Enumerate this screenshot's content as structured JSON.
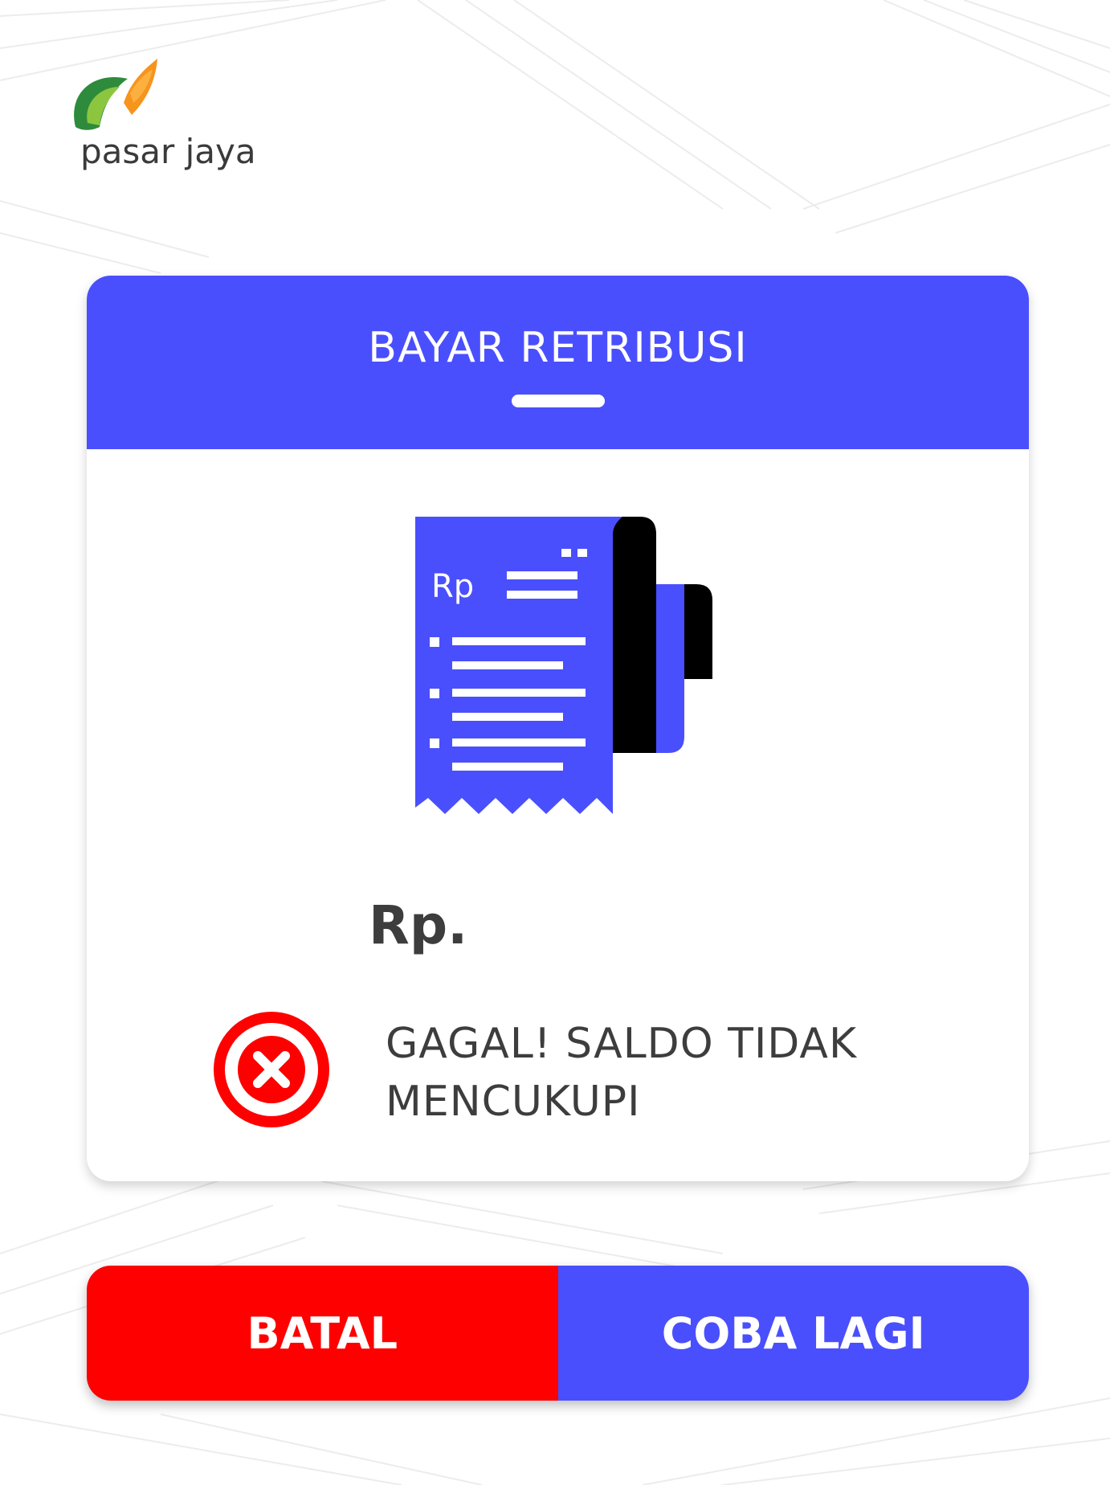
{
  "brand": {
    "logo_text": "pasar jaya",
    "logo_colors": [
      "#2e8b3c",
      "#8cc63f",
      "#f7941d"
    ]
  },
  "dialog": {
    "title": "BAYAR RETRIBUSI",
    "receipt_icon_label": "Rp",
    "amount_label": "Rp.",
    "error_message": "GAGAL! SALDO TIDAK MENCUKUPI"
  },
  "buttons": {
    "cancel_label": "BATAL",
    "retry_label": "COBA LAGI"
  },
  "colors": {
    "primary": "#4a4ffd",
    "danger": "#fe0000",
    "text_dark": "#3d3d3d"
  },
  "icons": [
    "receipt-icon",
    "error-x-icon"
  ]
}
